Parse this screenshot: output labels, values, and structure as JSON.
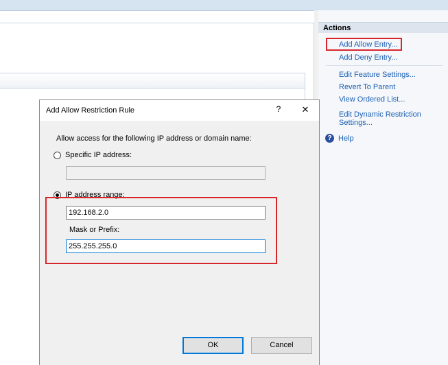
{
  "actions": {
    "header": "Actions",
    "add_allow_entry": "Add Allow Entry...",
    "add_deny_entry": "Add Deny Entry...",
    "edit_feature_settings": "Edit Feature Settings...",
    "revert_to_parent": "Revert To Parent",
    "view_ordered_list": "View Ordered List...",
    "edit_dynamic_restriction": "Edit Dynamic Restriction Settings...",
    "help": "Help",
    "help_icon": "question-circle-icon"
  },
  "dialog": {
    "title": "Add Allow Restriction Rule",
    "help_glyph": "?",
    "close_glyph": "✕",
    "intro": "Allow access for the following IP address or domain name:",
    "specific_ip_label": "Specific IP address:",
    "specific_ip_value": "",
    "specific_ip_selected": false,
    "range_label": "IP address range:",
    "range_selected": true,
    "range_value": "192.168.2.0",
    "mask_label": "Mask or Prefix:",
    "mask_value": "255.255.255.0",
    "ok_label": "OK",
    "cancel_label": "Cancel"
  },
  "colors": {
    "link": "#1a5fb4",
    "highlight": "#d8262b",
    "focus": "#0078d7"
  }
}
